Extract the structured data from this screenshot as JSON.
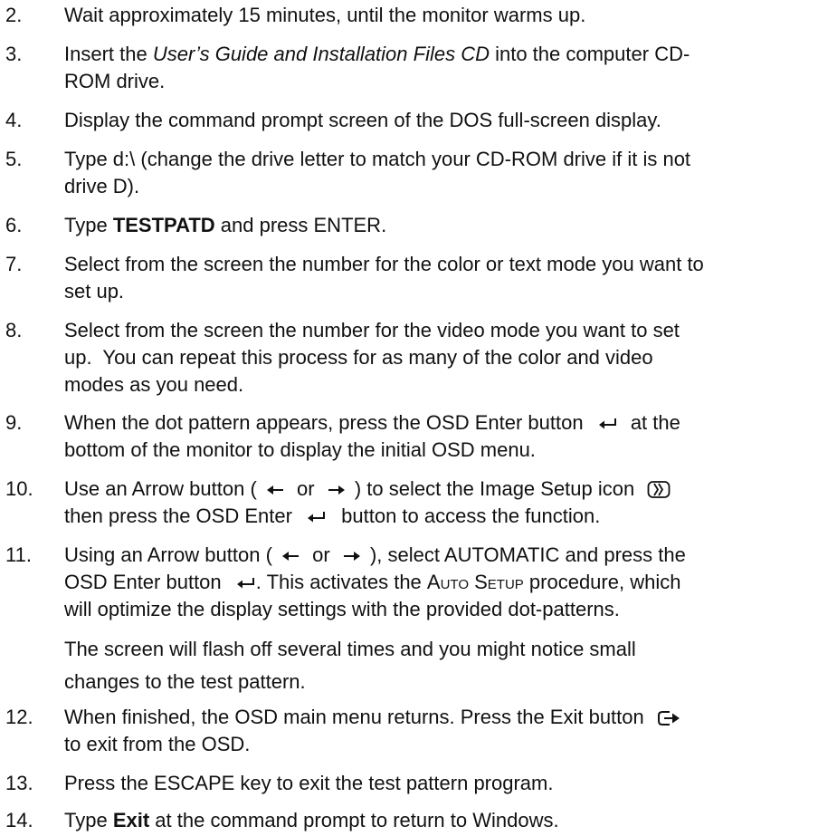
{
  "steps": [
    {
      "num": "2.",
      "text": "Wait approximately 15 minutes, until the monitor warms up."
    },
    {
      "num": "3.",
      "pre": "Insert the ",
      "ital": "User’s Guide and Installation Files CD",
      "post_l1": " into the computer CD-",
      "post_l2": "ROM drive."
    },
    {
      "num": "4.",
      "text": "Display the command prompt screen of the DOS full-screen display."
    },
    {
      "num": "5.",
      "l1": "Type d:\\ (change the drive letter to match your CD-ROM drive if it is not",
      "l2": "drive D)."
    },
    {
      "num": "6.",
      "pre": "Type ",
      "bold": "TESTPATD",
      "post": " and press ENTER."
    },
    {
      "num": "7.",
      "l1": "Select from the screen the number for the color or text mode you want to",
      "l2": "set up."
    },
    {
      "num": "8.",
      "l1": "Select from the screen the number for the video mode you want to set",
      "l2": "up.  You can repeat this process for as many of the color and video",
      "l3": "modes as you need."
    },
    {
      "num": "9.",
      "l1a": "When the dot pattern appears, press the OSD Enter button",
      "l1b": "at the",
      "l2": "bottom of the monitor to display the initial OSD menu."
    },
    {
      "num": "10.",
      "l1a": "Use an Arrow button (",
      "l1b": "or",
      "l1c": ") to select the Image Setup icon",
      "l2a": "then press the OSD Enter",
      "l2b": "button to access the function."
    },
    {
      "num": "11.",
      "l1a": "Using an Arrow button (",
      "l1b": "or",
      "l1c": "), select AUTOMATIC and press the",
      "l2a": "OSD Enter button",
      "l2b": ". This activates the",
      "l2sc": "Auto Setup",
      "l2c": "procedure, which",
      "l3": "will optimize the display settings with the provided dot-patterns.",
      "c1": "The screen will flash off several times and you might notice small",
      "c2": "changes to the test pattern."
    },
    {
      "num": "12.",
      "l1a": "When finished, the OSD main menu returns. Press the Exit button",
      "l2": "to exit from the OSD."
    },
    {
      "num": "13.",
      "text": "Press the ESCAPE key to exit the test pattern program."
    },
    {
      "num": "14.",
      "pre": "Type ",
      "bold": "Exit",
      "post": " at the command prompt to return to Windows."
    }
  ]
}
